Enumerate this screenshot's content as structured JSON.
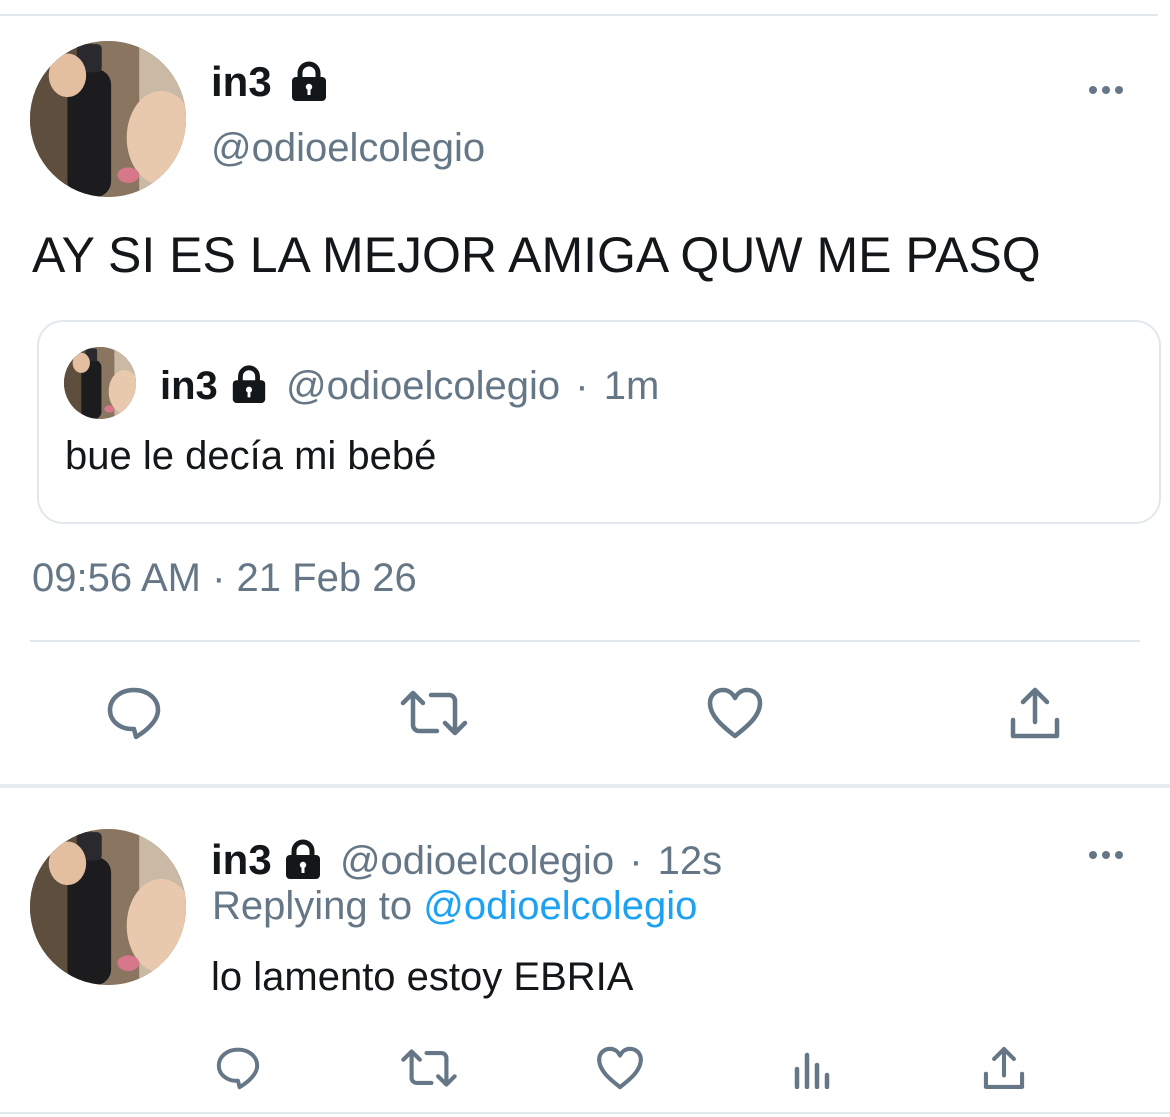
{
  "main_tweet": {
    "display_name": "in3",
    "handle": "@odioelcolegio",
    "text": "AY SI ES LA MEJOR AMIGA QUW ME PASQ",
    "timestamp": "09:56 AM · 21 Feb 26",
    "quoted": {
      "display_name": "in3",
      "handle": "@odioelcolegio",
      "separator": "·",
      "time": "1m",
      "text": "bue le decía mi bebé"
    },
    "actions": [
      "reply-icon",
      "retweet-icon",
      "like-icon",
      "share-icon"
    ]
  },
  "reply_tweet": {
    "display_name": "in3",
    "handle": "@odioelcolegio",
    "separator": "·",
    "time": "12s",
    "replying_label": "Replying to",
    "replying_to": "@odioelcolegio",
    "text": "lo lamento estoy EBRIA",
    "actions": [
      "reply-icon",
      "retweet-icon",
      "like-icon",
      "analytics-icon",
      "share-icon"
    ]
  },
  "colors": {
    "text": "#14171a",
    "secondary": "#657786",
    "accent": "#1da1f2",
    "divider": "#e1e8ed"
  }
}
